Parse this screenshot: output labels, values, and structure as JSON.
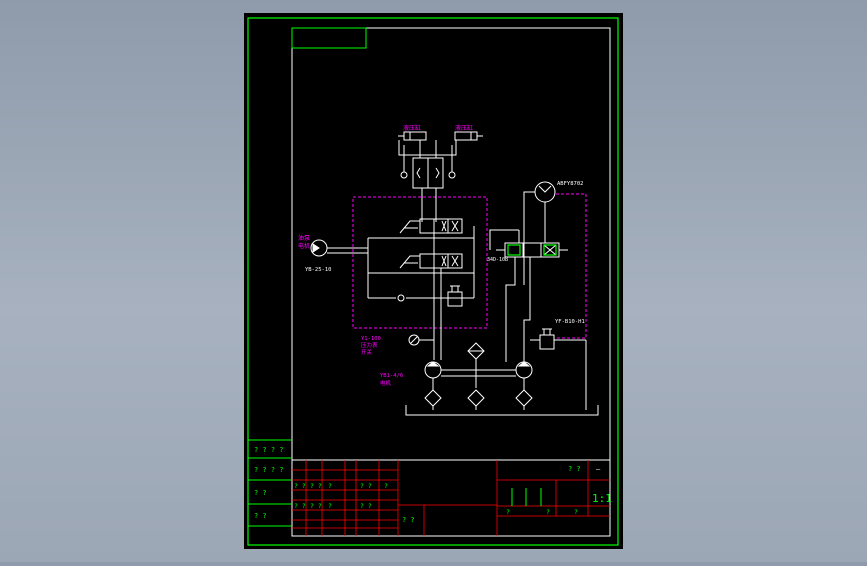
{
  "colors": {
    "background": "#000000",
    "frame": "#00ff00",
    "line": "#ffffff",
    "table": "#ff0000",
    "label": "#ff00ff",
    "boundary": "#ff00ff",
    "title_text": "#00ff00",
    "viewport": "#9aa5b4"
  },
  "labels": {
    "pump_left_top": "油泵",
    "pump_left_sub": "电机",
    "pump_left_model": "YB-25-10",
    "cylinder_left": "液压缸",
    "cylinder_right": "液压缸",
    "motor_right": "ABFY8702",
    "valve_right": "34D-10B",
    "relief_right": "YF-B10-H1",
    "gauge_model": "Y1-100",
    "gauge_sub": "压力表",
    "gauge_sub2": "开关",
    "pump_bottom": "YB1-4/6",
    "pump_bottom_sub": "电机"
  },
  "title_block": {
    "left_col": [
      "? ? ? ?",
      "? ? ? ?",
      "?  ?",
      "?  ?"
    ],
    "mid_row1": [
      "? ?",
      "? ?",
      "?",
      "? ?",
      "?"
    ],
    "mid_row2": [
      "? ?",
      "? ?",
      "?",
      "? ?"
    ],
    "right_top": [
      "? ?",
      "—"
    ],
    "right_big": "1:1",
    "right_row": [
      "?",
      "?",
      "?"
    ],
    "bottom_cell": "? ?"
  }
}
